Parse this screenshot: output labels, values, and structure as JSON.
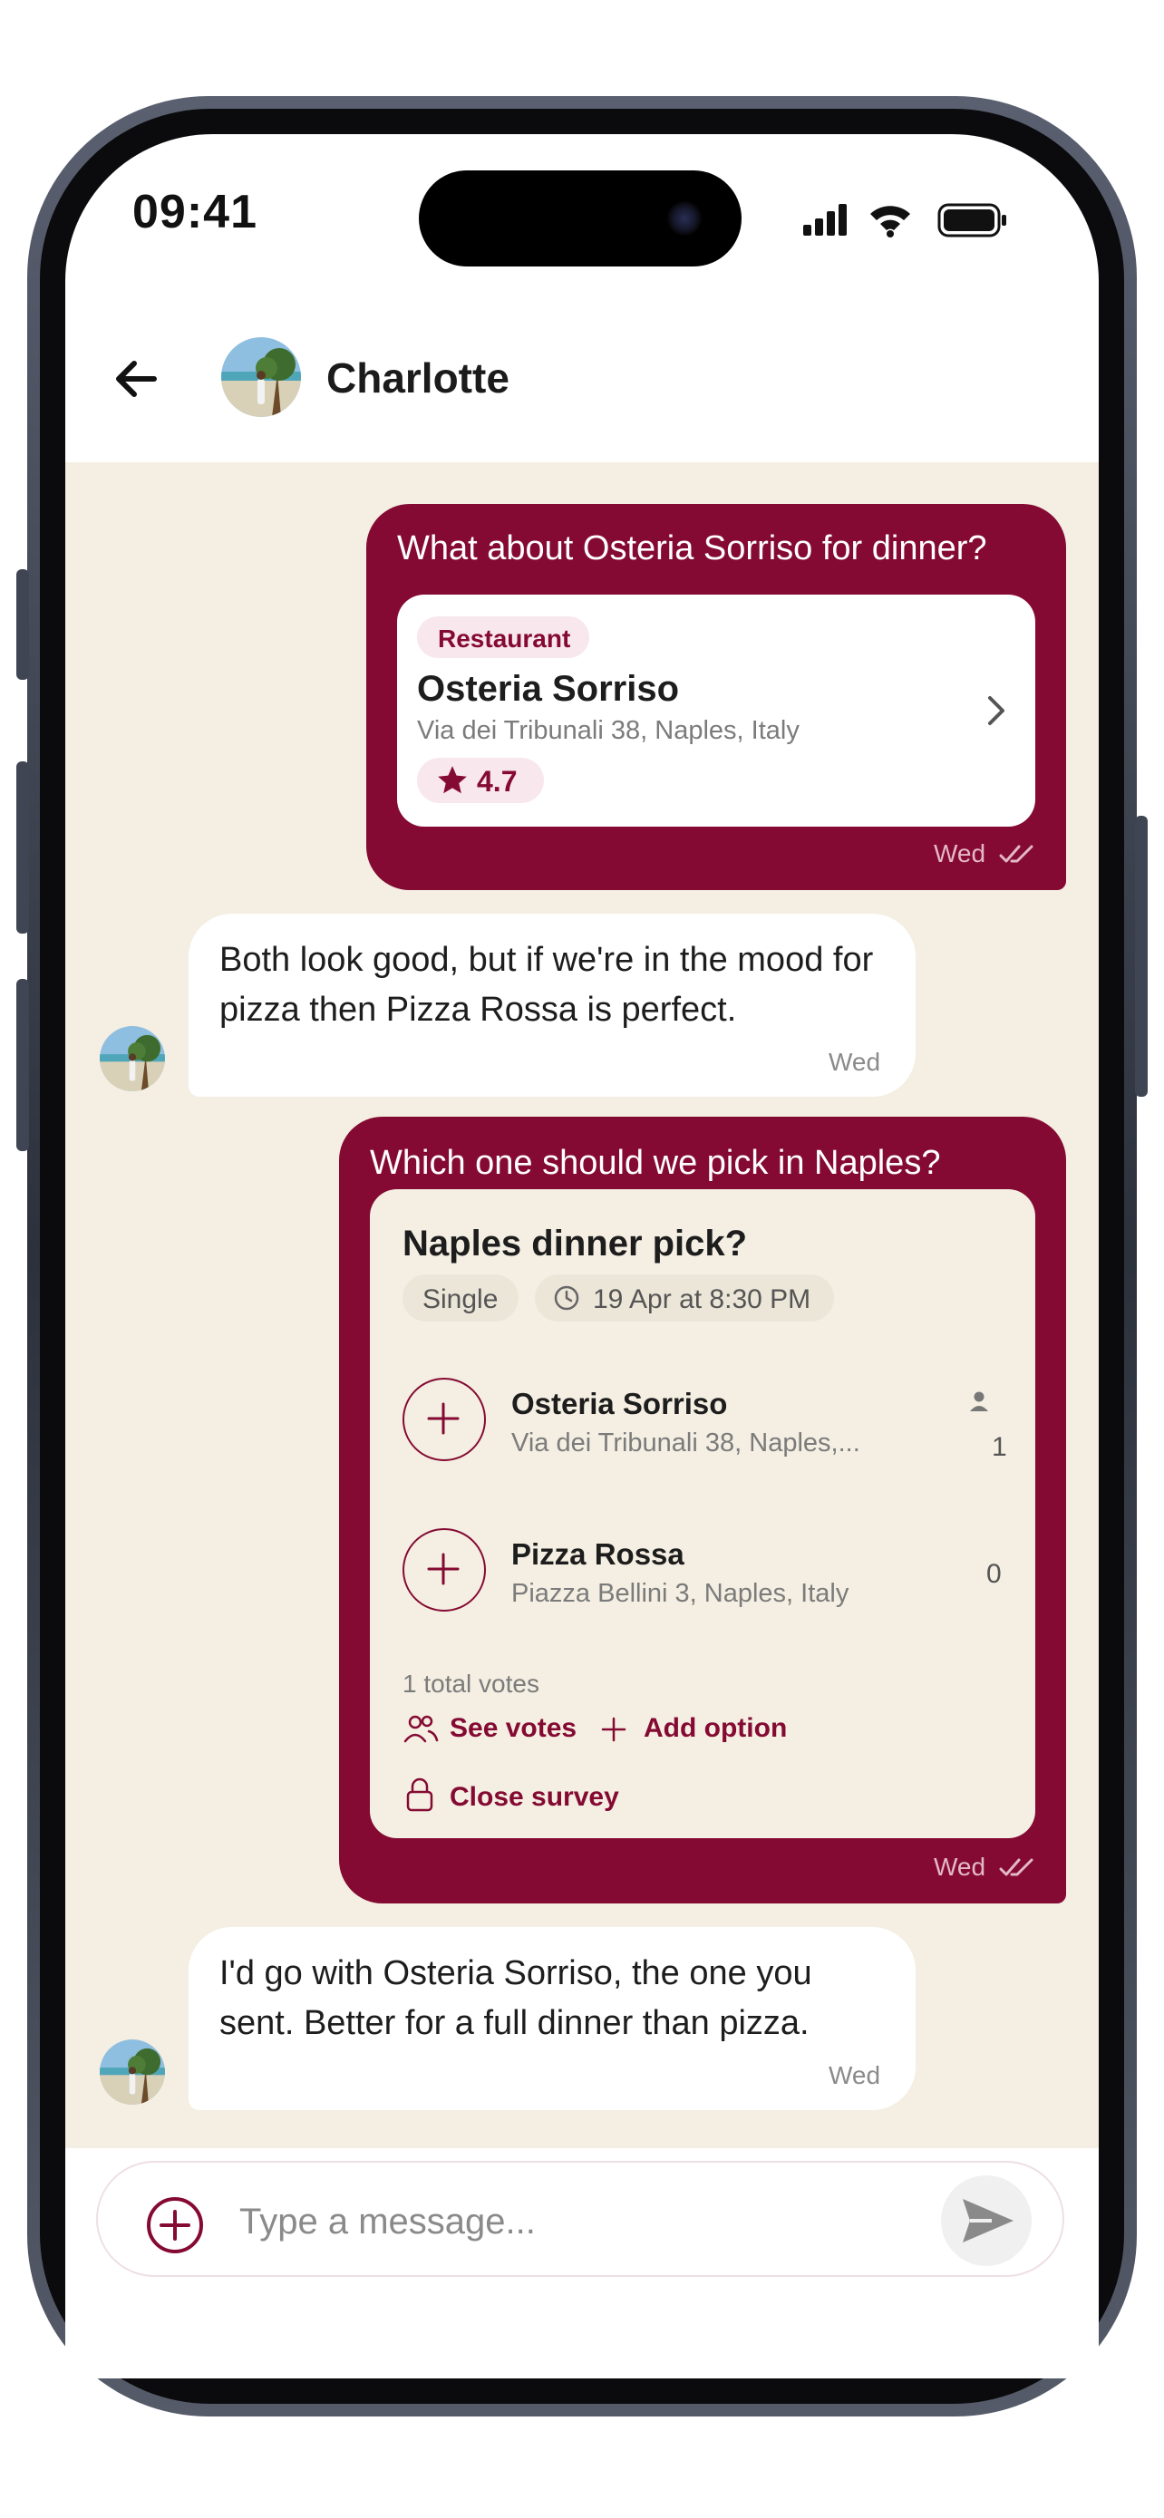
{
  "status_bar": {
    "time": "09:41"
  },
  "header": {
    "contact_name": "Charlotte"
  },
  "messages": [
    {
      "text": "What about Osteria Sorriso for dinner?",
      "place_card": {
        "category": "Restaurant",
        "name": "Osteria Sorriso",
        "address": "Via dei Tribunali 38, Naples, Italy",
        "rating": "4.7"
      },
      "time": "Wed"
    },
    {
      "text": "Both look good, but if we're in the mood for pizza then Pizza Rossa is perfect.",
      "time": "Wed"
    },
    {
      "text": "Which one should we pick in Naples?",
      "poll": {
        "title": "Naples dinner pick?",
        "mode": "Single",
        "deadline": "19 Apr at 8:30 PM",
        "options": [
          {
            "name": "Osteria Sorriso",
            "address": "Via dei Tribunali 38, Naples,...",
            "votes": "1"
          },
          {
            "name": "Pizza Rossa",
            "address": "Piazza Bellini 3, Naples, Italy",
            "votes": "0"
          }
        ],
        "total_votes": "1 total votes",
        "see_votes": "See votes",
        "add_option": "Add option",
        "close_survey": "Close survey"
      },
      "time": "Wed"
    },
    {
      "text": "I'd go with Osteria Sorriso, the one you sent. Better for a full dinner than pizza.",
      "time": "Wed"
    }
  ],
  "composer": {
    "placeholder": "Type a message..."
  },
  "colors": {
    "accent": "#850a33",
    "chat_background": "#f4efe2",
    "incoming_bubble": "#ffffff"
  },
  "icons": [
    "back-arrow-icon",
    "signal-icon",
    "wifi-icon",
    "battery-icon",
    "chevron-right-icon",
    "star-icon",
    "double-check-icon",
    "clock-icon",
    "plus-icon",
    "person-icon",
    "people-icon",
    "lock-icon",
    "send-icon"
  ]
}
